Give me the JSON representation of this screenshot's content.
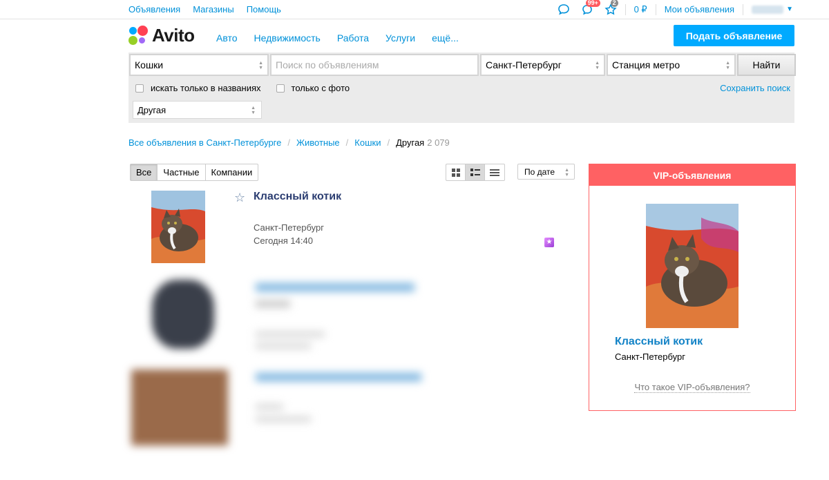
{
  "topbar": {
    "links": [
      "Объявления",
      "Магазины",
      "Помощь"
    ],
    "messages_badge": "99+",
    "favorites_badge": "2",
    "balance": "0 ₽",
    "my_ads": "Мои объявления"
  },
  "header": {
    "logo": "Avito",
    "nav": [
      "Авто",
      "Недвижимость",
      "Работа",
      "Услуги",
      "ещё..."
    ],
    "post_button": "Подать объявление"
  },
  "search": {
    "category": "Кошки",
    "query_placeholder": "Поиск по объявлениям",
    "city": "Санкт-Петербург",
    "metro": "Станция метро",
    "find_button": "Найти",
    "only_titles": "искать только в названиях",
    "only_photo": "только с фото",
    "save_search": "Сохранить поиск",
    "subcategory": "Другая"
  },
  "breadcrumbs": {
    "items": [
      "Все объявления в Санкт-Петербурге",
      "Животные",
      "Кошки"
    ],
    "current": "Другая",
    "count": "2 079"
  },
  "filters": {
    "seller_tabs": [
      "Все",
      "Частные",
      "Компании"
    ],
    "sort": "По дате"
  },
  "listing": {
    "title": "Классный котик",
    "city": "Санкт-Петербург",
    "date": "Сегодня 14:40"
  },
  "vip": {
    "header": "VIP-объявления",
    "title": "Классный котик",
    "city": "Санкт-Петербург",
    "what_is": "Что такое VIP-объявления?"
  },
  "colors": {
    "link": "#0091d9",
    "primary_button": "#00aaff",
    "vip_accent": "#ff6163"
  }
}
